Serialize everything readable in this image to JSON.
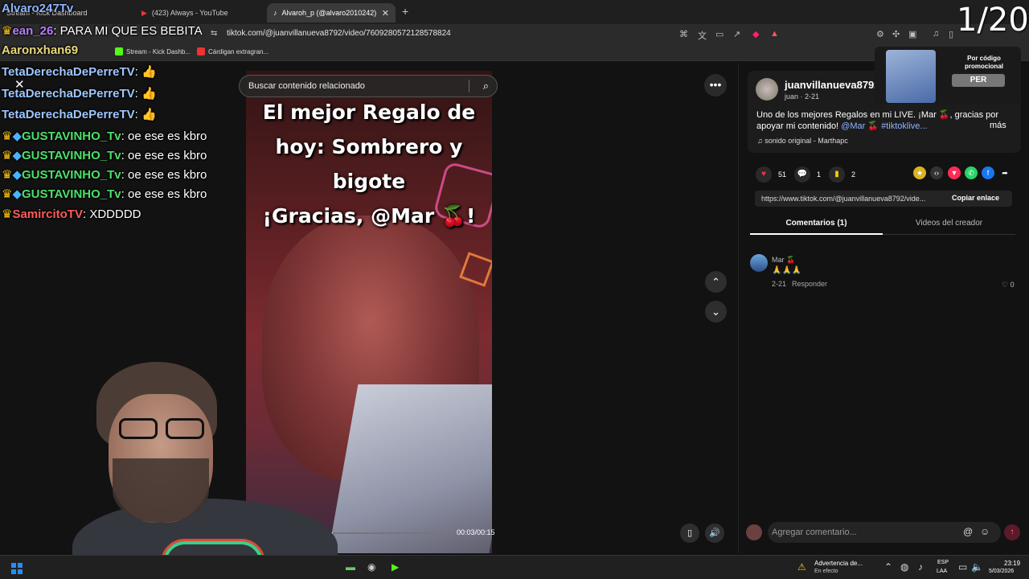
{
  "browser": {
    "tabs": [
      {
        "label": "Stream - Kick Dashboard"
      },
      {
        "label": "(423) Always - YouTube"
      },
      {
        "label": "Alvaroh_p (@alvaro2010242)"
      }
    ],
    "url": "tiktok.com/@juanvillanueva8792/video/7609280572128578824",
    "bookmarks": [
      {
        "label": "Stream - Kick Dashb..."
      },
      {
        "label": "Cárdigan extragran..."
      }
    ]
  },
  "stream": {
    "counter": "1/20",
    "chat": [
      {
        "user": "Alvaro247Tv",
        "message": "",
        "user_color": "#8fb4ff"
      },
      {
        "user": "ean_26",
        "message": ": PARA MI QUE ES BEBITA",
        "user_color": "#b77cff"
      },
      {
        "user": "Aaronxhan69",
        "message": "",
        "user_color": "#e8d87a"
      },
      {
        "user": "TetaDerechaDePerreTV",
        "message": ": 👍",
        "user_color": "#9fc7ff"
      },
      {
        "user": "TetaDerechaDePerreTV",
        "message": ": 👍",
        "user_color": "#9fc7ff"
      },
      {
        "user": "TetaDerechaDePerreTV",
        "message": ": 👍",
        "user_color": "#9fc7ff"
      },
      {
        "user": "GUSTAVINHO_Tv",
        "message": ": oe ese es kbro",
        "user_color": "#4be06a"
      },
      {
        "user": "GUSTAVINHO_Tv",
        "message": ": oe ese es kbro",
        "user_color": "#4be06a"
      },
      {
        "user": "GUSTAVINHO_Tv",
        "message": ": oe ese es kbro",
        "user_color": "#4be06a"
      },
      {
        "user": "GUSTAVINHO_Tv",
        "message": ": oe ese es kbro",
        "user_color": "#4be06a"
      },
      {
        "user": "SamircitoTV",
        "message": ": XDDDDD",
        "user_color": "#ff5a5a"
      }
    ],
    "promo": {
      "text": "Por código promocional",
      "button": "PER"
    }
  },
  "video": {
    "search_placeholder": "Buscar contenido relacionado",
    "caption": [
      "El mejor Regalo de",
      "hoy: Sombrero y",
      "bigote",
      "¡Gracias, @Mar 🍒!"
    ],
    "time": "00:03/00:15",
    "progress": 0.2
  },
  "post": {
    "username": "juanvillanueva8792",
    "subline": "juan · 2-21",
    "description_plain": "Uno de los mejores Regalos en mi LIVE. ¡Mar 🍒, gracias por apoyar mi contenido! ",
    "mention": "@Mar 🍒",
    "hashtag": "#tiktoklive...",
    "more": "más",
    "music": "♫  sonido original - Marthapc",
    "likes": "51",
    "comments": "1",
    "saves": "2",
    "link": "https://www.tiktok.com/@juanvillanueva8792/vide...",
    "copy_label": "Copiar enlace"
  },
  "tabs": {
    "comments": "Comentarios (1)",
    "videos": "Videos del creador"
  },
  "comment": {
    "name": "Mar 🍒",
    "text": "🙏🙏🙏",
    "date": "2-21",
    "reply": "Responder",
    "likes": "♡ 0"
  },
  "composer": {
    "placeholder": "Agregar comentario..."
  },
  "taskbar": {
    "warning_title": "Advertencia de...",
    "warning_sub": "En efecto",
    "lang1": "ESP",
    "lang2": "LAA",
    "time": "23:19",
    "date": "5/03/2026"
  },
  "colors": {
    "accent": "#fe2c55",
    "link": "#8fb4ff"
  }
}
